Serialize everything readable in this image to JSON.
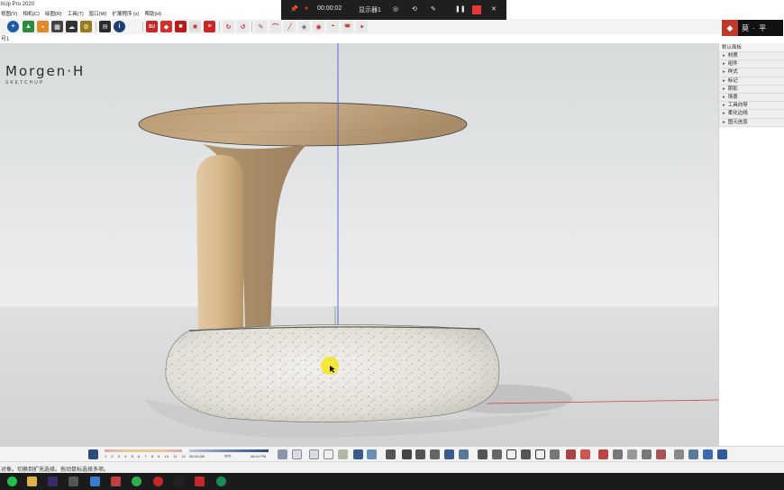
{
  "window": {
    "title": "hUp Pro 2020"
  },
  "menu": {
    "items": [
      "视图(V)",
      "相机(C)",
      "绘图(R)",
      "工具(T)",
      "窗口(W)",
      "扩展程序 (x)",
      "帮助(H)"
    ]
  },
  "toolbar": {
    "icons": [
      "add-icon",
      "tree-icon",
      "sun-icon",
      "checker-icon",
      "cloud-icon",
      "gear-icon",
      "mail-icon",
      "info-icon",
      "su-plugin-icon",
      "extension-icon",
      "red-cube-icon",
      "rotate-icon",
      "extrude-icon",
      "arc-icon",
      "surface-icon",
      "paint-icon"
    ]
  },
  "recorder": {
    "elapsed": "00:00:02",
    "display": "显示器1"
  },
  "brand": {
    "text": "莫 · 平"
  },
  "viewport": {
    "scene_tab": "号1",
    "watermark_title": "Morgen·H",
    "watermark_subtitle": "SKETCHUP"
  },
  "tray": {
    "title": "默认面板",
    "items": [
      "材质",
      "组件",
      "样式",
      "标记",
      "阴影",
      "场景",
      "工具向导",
      "柔化边线",
      "图元信息"
    ]
  },
  "shadow_bar": {
    "months": [
      "1",
      "2",
      "3",
      "4",
      "5",
      "6",
      "7",
      "8",
      "9",
      "10",
      "11",
      "12"
    ],
    "time_start": "05:44 AM",
    "time_mid": "中午",
    "time_end": "06:44 PM"
  },
  "status": {
    "text": "对象。切换到扩充选择。拖动鼠标选择多项。"
  },
  "colors": {
    "recorder_bg": "#1f1f1f",
    "record_red": "#e53935",
    "axis_blue": "#3a4fd0",
    "axis_red": "#d04040",
    "wood": "#c9a97e",
    "terrazzo": "#e6e3dc"
  }
}
